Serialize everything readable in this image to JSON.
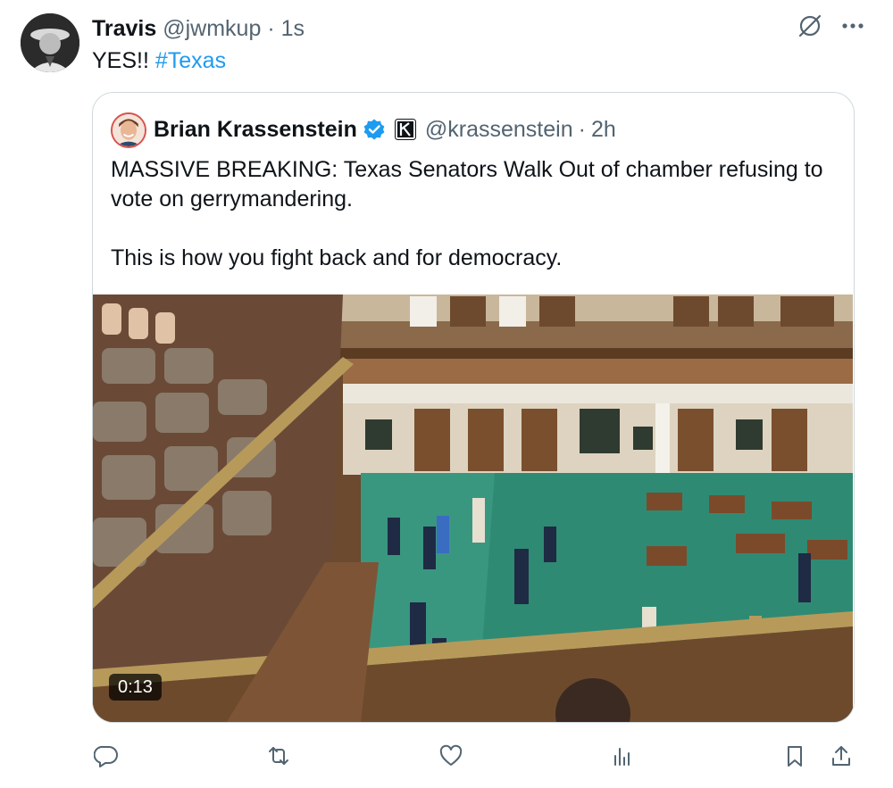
{
  "tweet": {
    "author_name": "Travis",
    "handle": "@jwmkup",
    "separator": "·",
    "time": "1s",
    "text_prefix": "YES!! ",
    "hashtag": "#Texas"
  },
  "quote": {
    "author_name": "Brian Krassenstein",
    "handle": "@krassenstein",
    "separator": "·",
    "time": "2h",
    "paragraph_1": "MASSIVE BREAKING: Texas Senators Walk Out of chamber refusing to vote on gerrymandering.",
    "paragraph_2": "This is how you fight back and for democracy.",
    "video_duration": "0:13"
  },
  "icons": {
    "grok": "grok-icon",
    "more": "more-icon",
    "verified": "verified-badge-icon",
    "affiliation": "affiliation-k-icon",
    "reply": "reply-icon",
    "retweet": "retweet-icon",
    "like": "like-icon",
    "views": "views-icon",
    "bookmark": "bookmark-icon",
    "share": "share-icon"
  },
  "colors": {
    "link": "#1d9bf0",
    "muted": "#536471",
    "verified": "#1d9bf0"
  }
}
